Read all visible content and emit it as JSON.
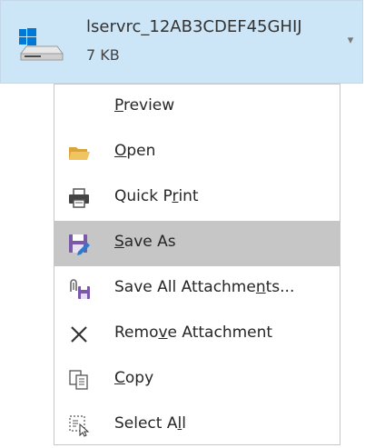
{
  "attachment": {
    "name": "lservrc_12AB3CDEF45GHIJ",
    "size": "7 KB"
  },
  "menu": {
    "items": [
      {
        "pre": "",
        "acc": "P",
        "post": "review",
        "icon": "none",
        "highlighted": false
      },
      {
        "pre": "",
        "acc": "O",
        "post": "pen",
        "icon": "folder-icon",
        "highlighted": false
      },
      {
        "pre": "Quick P",
        "acc": "r",
        "post": "int",
        "icon": "printer-icon",
        "highlighted": false
      },
      {
        "pre": "",
        "acc": "S",
        "post": "ave As",
        "icon": "save-as-icon",
        "highlighted": true
      },
      {
        "pre": "Save All Attachme",
        "acc": "n",
        "post": "ts...",
        "icon": "save-all-attachments-icon",
        "highlighted": false
      },
      {
        "pre": "Remo",
        "acc": "v",
        "post": "e Attachment",
        "icon": "remove-x-icon",
        "highlighted": false
      },
      {
        "pre": "",
        "acc": "C",
        "post": "opy",
        "icon": "copy-icon",
        "highlighted": false
      },
      {
        "pre": "Select A",
        "acc": "l",
        "post": "l",
        "icon": "select-all-icon",
        "highlighted": false
      }
    ]
  },
  "colors": {
    "header_bg": "#cde6f7",
    "highlight_bg": "#c6c6c6",
    "windows_blue": "#0078d7",
    "folder_yellow": "#e9b54b",
    "save_purple": "#7a5aa8"
  }
}
